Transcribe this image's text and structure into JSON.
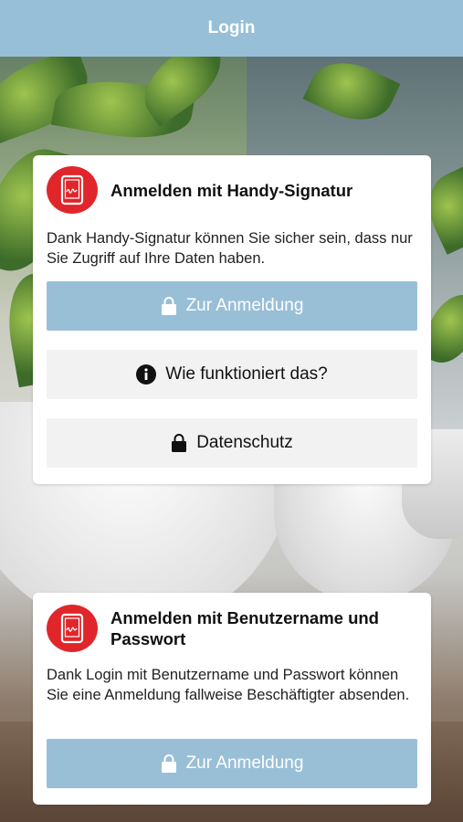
{
  "header": {
    "title": "Login"
  },
  "card_signature": {
    "title": "Anmelden mit Handy-Signatur",
    "text": "Dank Handy-Signatur können Sie sicher sein, dass nur Sie Zugriff auf Ihre Daten haben.",
    "login_button": "Zur Anmeldung",
    "info_button": "Wie funktioniert das?",
    "privacy_button": "Datenschutz"
  },
  "card_password": {
    "title": "Anmelden mit Benutzername und Passwort",
    "text": "Dank Login mit Benutzername und Passwort können Sie eine Anmeldung fallweise Beschäftigter absenden.",
    "login_button": "Zur Anmeldung"
  },
  "colors": {
    "header_bg": "#98bfd8",
    "primary_button": "#99bfd7",
    "secondary_button": "#f2f2f2",
    "logo_red": "#e0262b"
  },
  "icons": [
    "lock-icon",
    "info-icon",
    "handy-signatur-logo-icon"
  ]
}
